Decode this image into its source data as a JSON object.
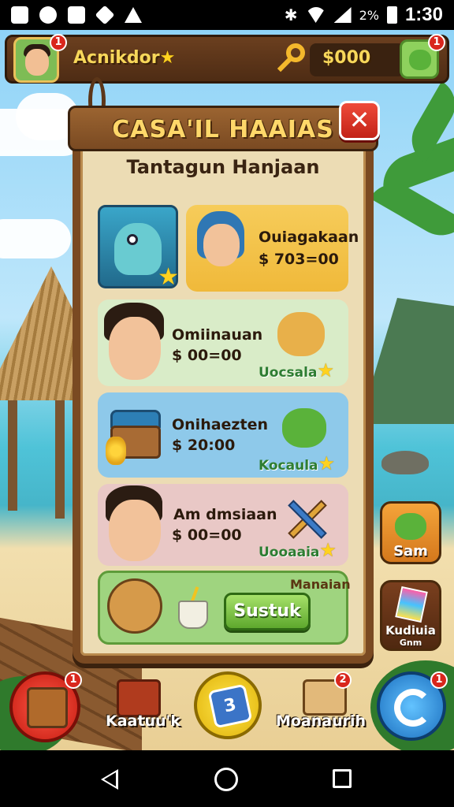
{
  "status_bar": {
    "battery_percent": "2%",
    "time": "1:30",
    "icons": [
      "image-icon",
      "whatsapp-icon",
      "clipboard-icon",
      "game-icon",
      "warning-icon",
      "bluetooth-icon",
      "wifi-icon",
      "signal-icon",
      "battery-icon"
    ]
  },
  "hud": {
    "player_name": "Acnikdor",
    "avatar_badge": "1",
    "coins": "$000",
    "pet_badge": "1"
  },
  "panel": {
    "title": "CASA'IL HAAIAS",
    "subtitle": "Tantagun Hanjaan",
    "close_label": "✕"
  },
  "cards": [
    {
      "name": "Ouiagakaan",
      "price": "$ 703=00"
    },
    {
      "name": "Omiinauan",
      "price": "$ 00=00",
      "tag": "Uocsala"
    },
    {
      "name": "Onihaezten",
      "price": "$ 20:00",
      "tag": "Kocaula"
    },
    {
      "name": "Am dmsiaan",
      "price": "$ 00=00",
      "tag": "Uooaaia"
    }
  ],
  "last_card": {
    "label": "Manaian",
    "button": "Sustuk"
  },
  "side_buttons": {
    "sam": "Sam",
    "kudiuia": "Kudiuia",
    "kudiuia_sub": "Gnm"
  },
  "bottom_nav": {
    "item1_badge": "1",
    "item2_label": "Kaatuu'k",
    "item3_number": "3",
    "item4_label": "Moanaurih",
    "item4_badge": "2",
    "item5_badge": "1"
  },
  "colors": {
    "wood": "#7a4a22",
    "parchment": "#ecdcb4",
    "gold_text": "#f7d75a",
    "close_red": "#d9261c",
    "button_green": "#5ea82d"
  }
}
